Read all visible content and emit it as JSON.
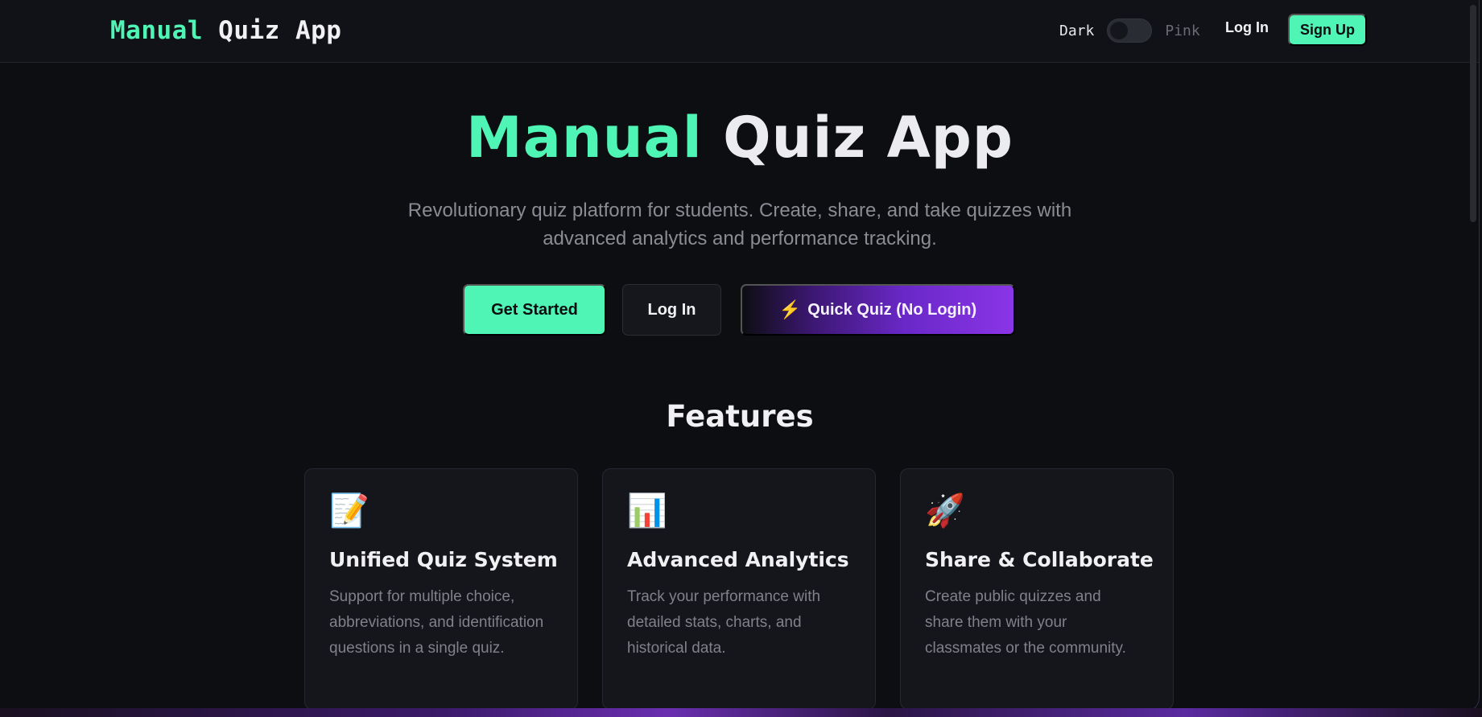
{
  "navbar": {
    "brand_accent": "Manual",
    "brand_rest": "Quiz App",
    "theme_dark_label": "Dark",
    "theme_pink_label": "Pink",
    "login_label": "Log In",
    "signup_label": "Sign Up"
  },
  "hero": {
    "title_accent": "Manual",
    "title_rest": "Quiz App",
    "subtitle": "Revolutionary quiz platform for students. Create, share, and take quizzes with advanced analytics and performance tracking.",
    "get_started_label": "Get Started",
    "login_label": "Log In",
    "quick_quiz_icon": "⚡",
    "quick_quiz_label": "Quick Quiz (No Login)"
  },
  "features": {
    "title": "Features",
    "cards": [
      {
        "icon": "📝",
        "title": "Unified Quiz System",
        "description": "Support for multiple choice, abbreviations, and identification questions in a single quiz."
      },
      {
        "icon": "📊",
        "title": "Advanced Analytics",
        "description": "Track your performance with detailed stats, charts, and historical data."
      },
      {
        "icon": "🚀",
        "title": "Share & Collaborate",
        "description": "Create public quizzes and share them with your classmates or the community."
      }
    ]
  },
  "colors": {
    "accent": "#4ff5b4",
    "background": "#0d0e12",
    "card": "#15161b",
    "purple": "#8a35e6"
  },
  "icons": {
    "theme_switch": "toggle-switch-icon",
    "quick_quiz": "lightning-bolt-icon",
    "card_1": "memo-icon",
    "card_2": "bar-chart-icon",
    "card_3": "rocket-icon"
  }
}
